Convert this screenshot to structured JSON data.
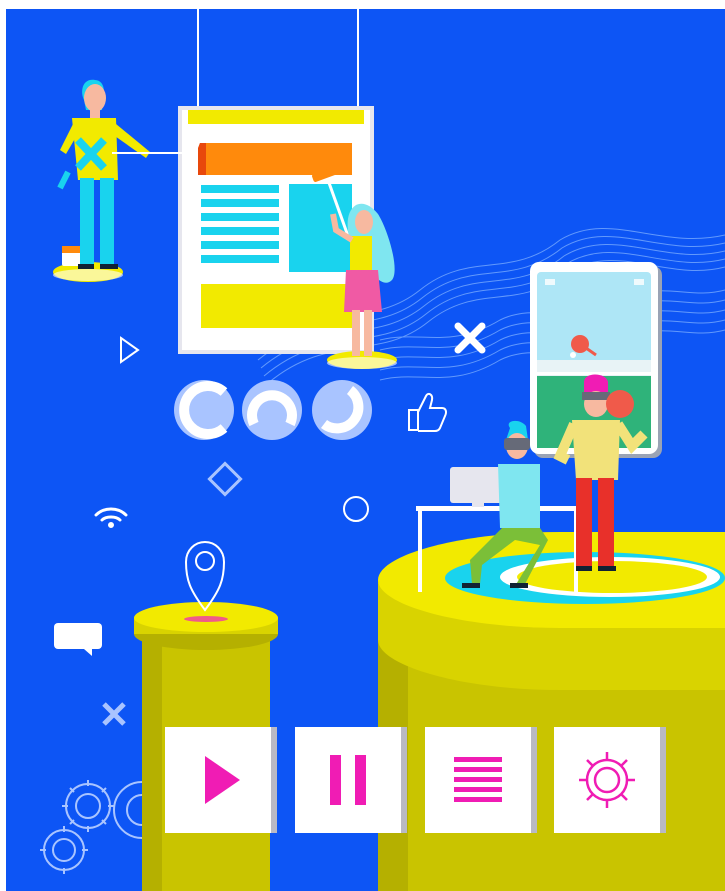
{
  "illustration": {
    "theme": "flat design / web development concept",
    "colors": {
      "background": "#0d55f5",
      "accent_yellow": "#f2ea00",
      "accent_cyan": "#19d3ee",
      "accent_magenta": "#f01cb4",
      "accent_orange": "#ff8a0c",
      "pillar_olive": "#c9c400"
    }
  },
  "controls": {
    "play_icon": "play-icon",
    "pause_icon": "pause-icon",
    "menu_icon": "menu-lines-icon",
    "settings_icon": "gear-icon"
  },
  "loaders": [
    "loader-1-icon",
    "loader-2-icon",
    "loader-3-icon"
  ],
  "floating_icons": [
    "play-outline-icon",
    "close-icon",
    "thumbs-up-icon",
    "diamond-icon",
    "wifi-icon",
    "circle-icon",
    "location-pin-icon",
    "chat-bubble-icon",
    "small-x-icon",
    "gears-icon"
  ]
}
